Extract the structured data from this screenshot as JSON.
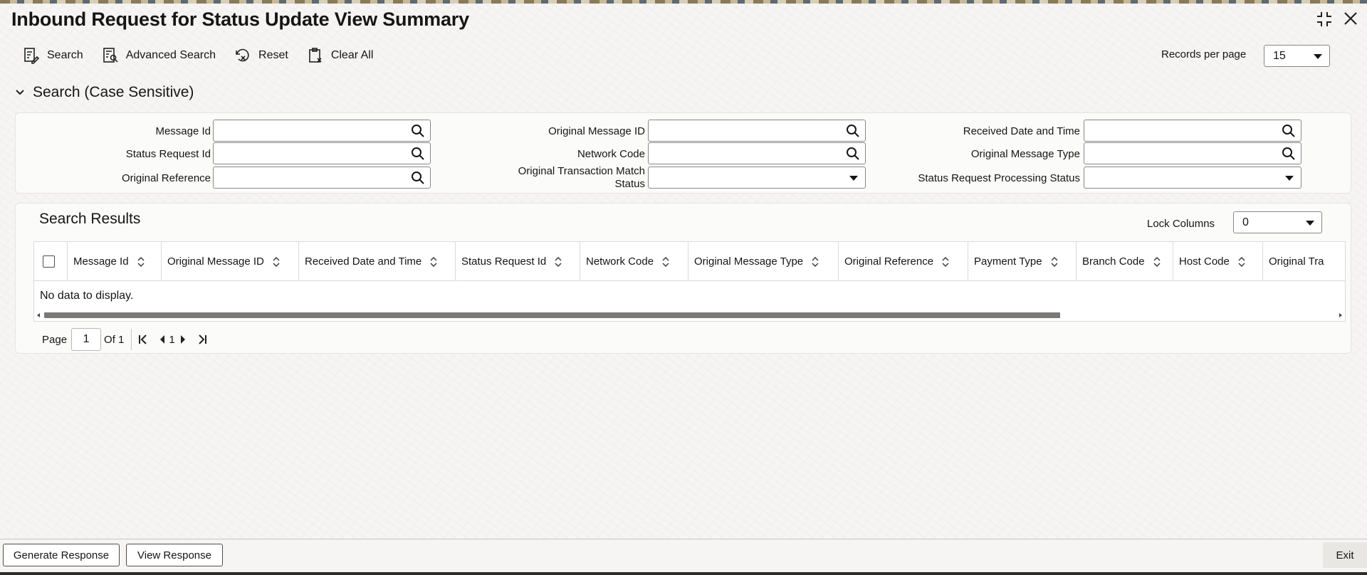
{
  "title": "Inbound Request for Status Update View Summary",
  "toolbar": {
    "search": "Search",
    "advanced_search": "Advanced Search",
    "reset": "Reset",
    "clear_all": "Clear All"
  },
  "records_per_page": {
    "label": "Records per page",
    "value": "15"
  },
  "search_section": {
    "label": "Search (Case Sensitive)"
  },
  "fields": {
    "message_id": "Message Id",
    "status_request_id": "Status Request Id",
    "original_reference": "Original Reference",
    "original_message_id": "Original Message ID",
    "network_code": "Network Code",
    "original_transaction_match_status_line1": "Original Transaction Match",
    "original_transaction_match_status_line2": "Status",
    "received_date_time": "Received Date and Time",
    "original_message_type": "Original Message Type",
    "status_request_processing_status": "Status Request Processing Status"
  },
  "results": {
    "title": "Search Results",
    "lock_columns_label": "Lock Columns",
    "lock_columns_value": "0",
    "columns": [
      "Message Id",
      "Original Message ID",
      "Received Date and Time",
      "Status Request Id",
      "Network Code",
      "Original Message Type",
      "Original Reference",
      "Payment Type",
      "Branch Code",
      "Host Code",
      "Original Tra"
    ],
    "no_data": "No data to display."
  },
  "pager": {
    "page_label": "Page",
    "page_value": "1",
    "of_label": "Of 1",
    "current": "1"
  },
  "footer": {
    "generate_response": "Generate Response",
    "view_response": "View Response",
    "exit": "Exit"
  }
}
